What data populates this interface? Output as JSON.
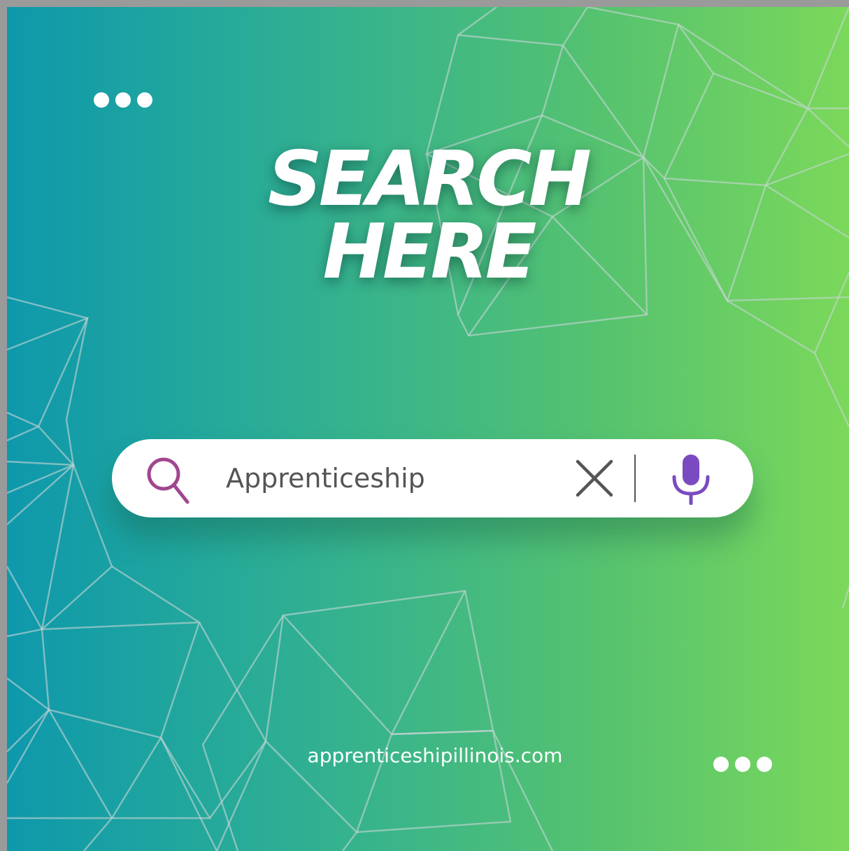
{
  "headline": {
    "line1": "SEARCH",
    "line2": "HERE"
  },
  "search": {
    "query": "Apprenticeship"
  },
  "footer": {
    "url": "apprenticeshipillinois.com"
  },
  "icons": {
    "search": "search-icon",
    "clear": "close-icon",
    "mic": "microphone-icon",
    "dots": "ellipsis-icon"
  },
  "colors": {
    "gradient_start": "#0e98ac",
    "gradient_end": "#7bd85a",
    "search_icon": "#a0478f",
    "mic_icon": "#7a4bc0",
    "mesh_lines": "#c8d6d6"
  }
}
